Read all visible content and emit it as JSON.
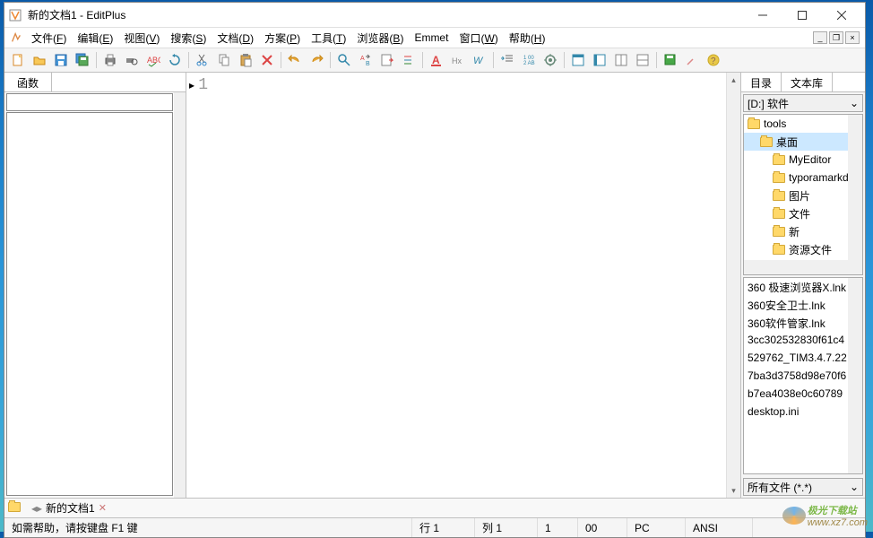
{
  "titlebar": {
    "title": "新的文档1 - EditPlus"
  },
  "menubar": {
    "items": [
      {
        "label": "文件(F)",
        "key": "F"
      },
      {
        "label": "编辑(E)",
        "key": "E"
      },
      {
        "label": "视图(V)",
        "key": "V"
      },
      {
        "label": "搜索(S)",
        "key": "S"
      },
      {
        "label": "文档(D)",
        "key": "D"
      },
      {
        "label": "方案(P)",
        "key": "P"
      },
      {
        "label": "工具(T)",
        "key": "T"
      },
      {
        "label": "浏览器(B)",
        "key": "B"
      },
      {
        "label": "Emmet",
        "key": ""
      },
      {
        "label": "窗口(W)",
        "key": "W"
      },
      {
        "label": "帮助(H)",
        "key": "H"
      }
    ]
  },
  "left_panel": {
    "tab_label": "函数"
  },
  "editor": {
    "line_number": "1"
  },
  "right_panel": {
    "tabs": [
      {
        "label": "目录",
        "active": true
      },
      {
        "label": "文本库",
        "active": false
      }
    ],
    "drive": "[D:] 软件",
    "tree": [
      {
        "label": "tools",
        "indent": 0,
        "selected": false
      },
      {
        "label": "桌面",
        "indent": 1,
        "selected": true
      },
      {
        "label": "MyEditor",
        "indent": 2,
        "selected": false
      },
      {
        "label": "typoramarkd",
        "indent": 2,
        "selected": false
      },
      {
        "label": "图片",
        "indent": 2,
        "selected": false
      },
      {
        "label": "文件",
        "indent": 2,
        "selected": false
      },
      {
        "label": "新",
        "indent": 2,
        "selected": false
      },
      {
        "label": "资源文件",
        "indent": 2,
        "selected": false
      }
    ],
    "files": [
      "360 极速浏览器X.lnk",
      "360安全卫士.lnk",
      "360软件管家.lnk",
      "3cc302532830f61c4",
      "529762_TIM3.4.7.22",
      "7ba3d3758d98e70f6",
      "b7ea4038e0c60789",
      "desktop.ini"
    ],
    "filter": "所有文件 (*.*)"
  },
  "doc_tabs": {
    "items": [
      {
        "label": "新的文档1"
      }
    ]
  },
  "statusbar": {
    "help": "如需帮助，请按键盘 F1 键",
    "line": "行 1",
    "col": "列 1",
    "sel": "1",
    "count": "00",
    "mode": "PC",
    "encoding": "ANSI"
  },
  "watermark": {
    "name": "极光下载站",
    "url": "www.xz7.com"
  }
}
